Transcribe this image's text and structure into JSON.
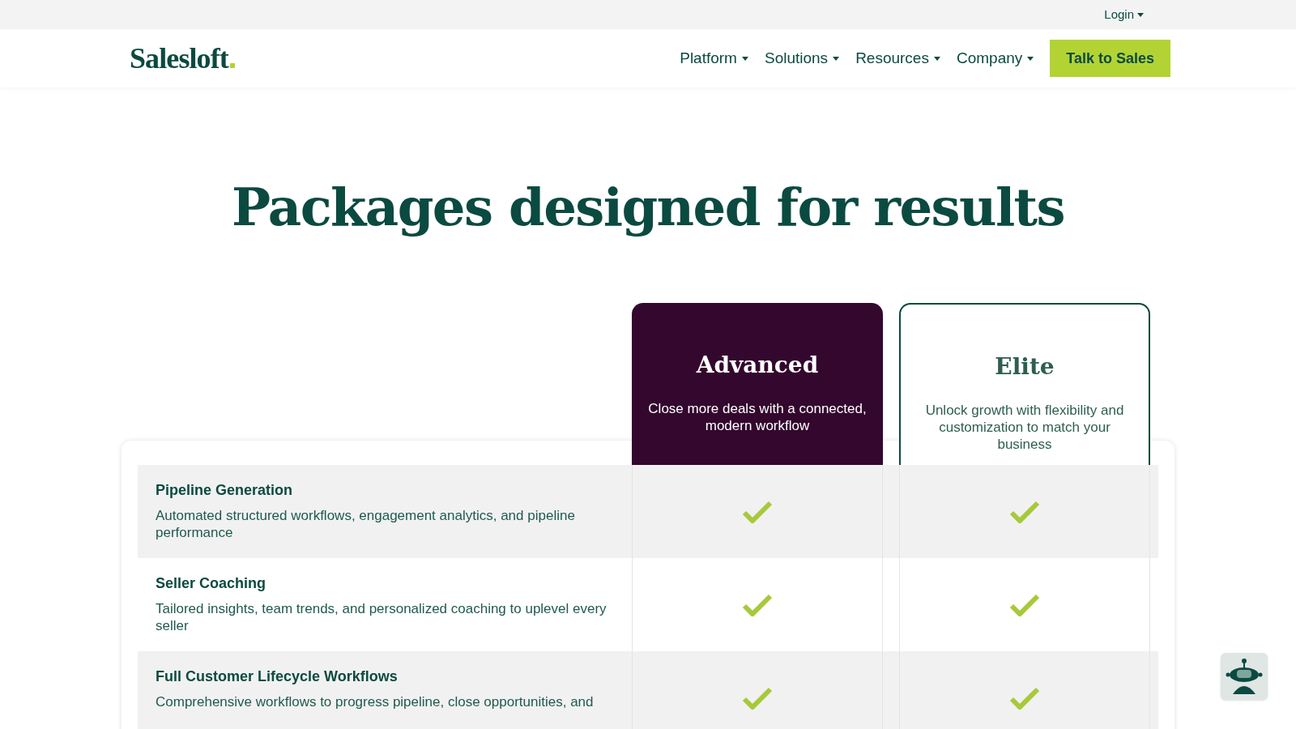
{
  "top_bar": {
    "login": "Login"
  },
  "nav": {
    "logo": "Salesloft",
    "items": [
      "Platform",
      "Solutions",
      "Resources",
      "Company"
    ],
    "cta": "Talk to Sales"
  },
  "heading": "Packages designed for results",
  "plans": [
    {
      "name": "Advanced",
      "description": "Close more deals with a connected, modern workflow",
      "highlighted": true
    },
    {
      "name": "Elite",
      "description": "Unlock growth with flexibility and customization to match your business",
      "highlighted": false
    }
  ],
  "features": [
    {
      "title": "Pipeline Generation",
      "description": "Automated structured workflows, engagement analytics, and pipeline performance",
      "included": [
        true,
        true
      ]
    },
    {
      "title": "Seller Coaching",
      "description": "Tailored insights, team trends, and personalized coaching to uplevel every seller",
      "included": [
        true,
        true
      ]
    },
    {
      "title": "Full Customer Lifecycle Workflows",
      "description": "Comprehensive workflows to progress pipeline, close opportunities, and",
      "included": [
        true,
        true
      ]
    }
  ]
}
